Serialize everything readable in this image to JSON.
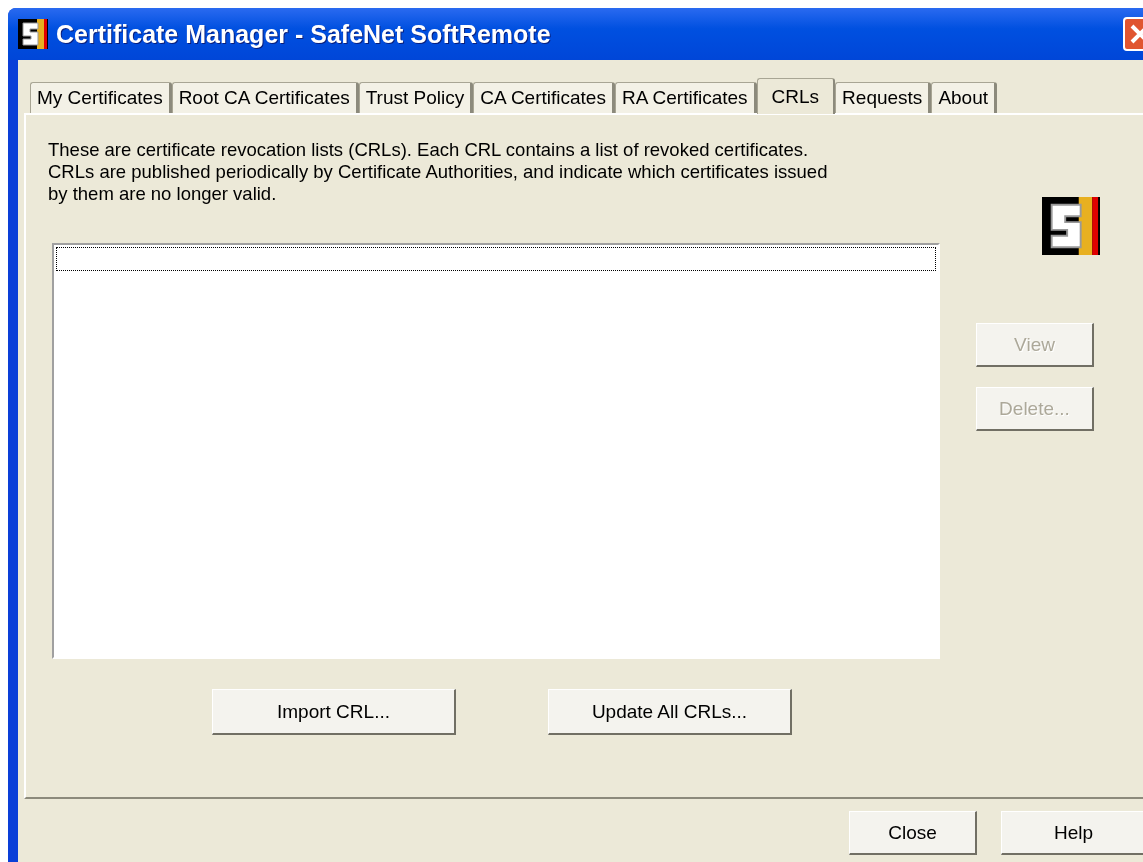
{
  "window": {
    "title": "Certificate Manager - SafeNet SoftRemote"
  },
  "tabs": [
    {
      "label": "My Certificates",
      "selected": false
    },
    {
      "label": "Root CA Certificates",
      "selected": false
    },
    {
      "label": "Trust Policy",
      "selected": false
    },
    {
      "label": "CA Certificates",
      "selected": false
    },
    {
      "label": "RA Certificates",
      "selected": false
    },
    {
      "label": "CRLs",
      "selected": true
    },
    {
      "label": "Requests",
      "selected": false
    },
    {
      "label": "About",
      "selected": false
    }
  ],
  "description": "These are certificate revocation lists (CRLs).  Each CRL contains a list of revoked certificates.  CRLs are published periodically by Certificate Authorities, and indicate which certificates issued by them are no longer valid.",
  "side_buttons": [
    {
      "label": "View",
      "disabled": true
    },
    {
      "label": "Delete...",
      "disabled": true
    }
  ],
  "panel_buttons": [
    {
      "label": "Import CRL...",
      "disabled": false
    },
    {
      "label": "Update All CRLs...",
      "disabled": false
    }
  ],
  "dialog_buttons": [
    {
      "label": "Close",
      "disabled": false
    },
    {
      "label": "Help",
      "disabled": false
    }
  ]
}
